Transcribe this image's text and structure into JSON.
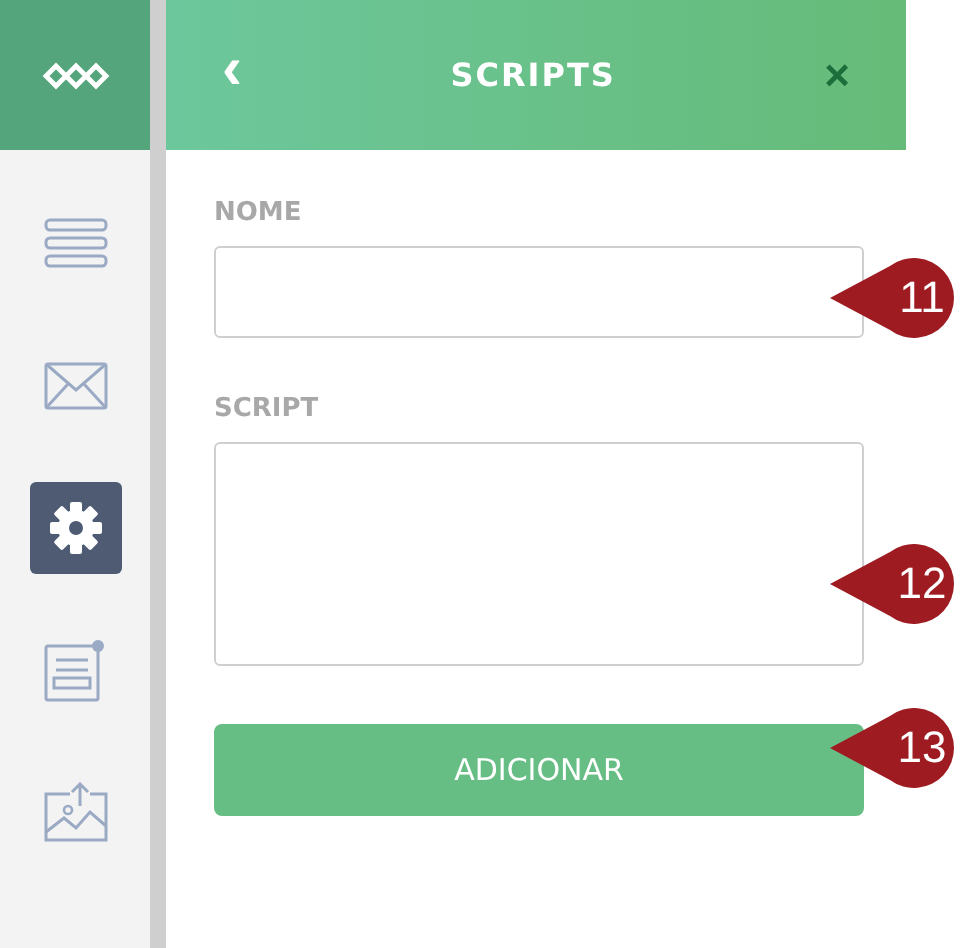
{
  "sidebar": {
    "items": [
      {
        "kind": "list",
        "selected": false
      },
      {
        "kind": "mail",
        "selected": false
      },
      {
        "kind": "settings",
        "selected": true
      },
      {
        "kind": "form",
        "selected": false
      },
      {
        "kind": "image",
        "selected": false
      }
    ]
  },
  "header": {
    "back": "‹",
    "title": "SCRIPTS",
    "close": "×"
  },
  "form": {
    "fields": [
      {
        "kind": "input",
        "label": "NOME"
      },
      {
        "kind": "textarea",
        "label": "SCRIPT"
      }
    ],
    "button": "ADICIONAR"
  },
  "callouts": [
    {
      "number": "11"
    },
    {
      "number": "12"
    },
    {
      "number": "13"
    }
  ]
}
